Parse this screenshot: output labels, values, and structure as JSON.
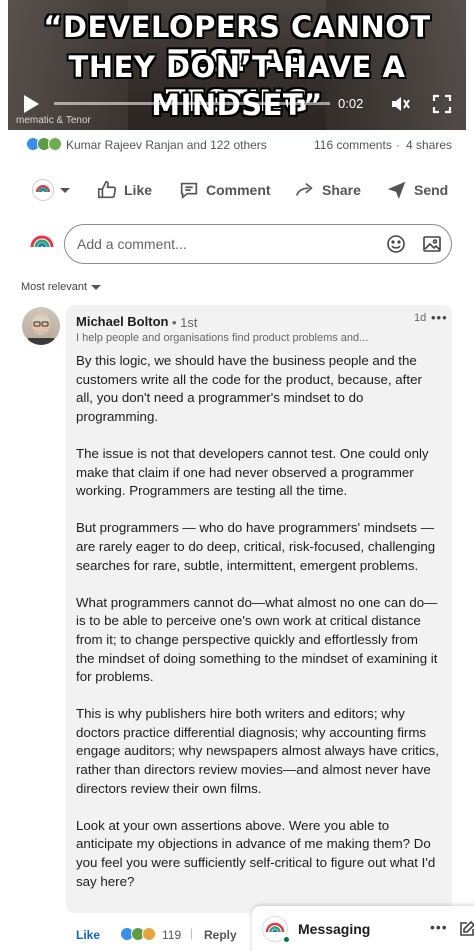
{
  "video": {
    "caption_lines": [
      "“DEVELOPERS CANNOT TEST AS",
      "THEY DON’T HAVE A TESTING",
      "MINDSET”"
    ],
    "time": "0:02",
    "progress": 0.0,
    "credit": "mematic & Tenor"
  },
  "social": {
    "reactors": "Kumar Rajeev Ranjan and 122 others",
    "comments": "116 comments",
    "shares": "4 shares"
  },
  "actions": {
    "like": "Like",
    "comment": "Comment",
    "share": "Share",
    "send": "Send"
  },
  "comment_box": {
    "placeholder": "Add a comment..."
  },
  "sort": {
    "label": "Most relevant"
  },
  "comment": {
    "author": "Michael Bolton",
    "degree": "• 1st",
    "headline": "I help people and organisations find product problems and...",
    "time": "1d",
    "paragraphs": [
      "By this logic, we should have the business people and the customers write all the code for the product, because, after all, you don't need a programmer's mindset to do programming.",
      "The issue is not that developers cannot test. One could only make that claim if one had never observed a programmer working. Programmers are testing all the time.",
      "But programmers — who do have programmers' mindsets — are rarely eager to do deep, critical, risk-focused, challenging searches for rare, subtle, intermittent, emergent problems.",
      "What programmers cannot do—what almost no one can do—is to be able to perceive one's own work at critical distance from it; to change perspective quickly and effortlessly from the mindset of doing something to the mindset of examining it for problems.",
      "This is why publishers hire both writers and editors; why doctors practice differential diagnosis; why accounting firms engage auditors; why newspapers almost always have critics, rather than directors review movies—and almost never have directors review their own films.",
      "Look at your own assertions above. Were you able to anticipate my objections in advance of me making them? Do you feel you were sufficiently self-critical to figure out what I'd say here?"
    ],
    "like_label": "Like",
    "reaction_count": "119",
    "separator": "|",
    "reply_label": "Reply"
  },
  "messaging": {
    "title": "Messaging"
  },
  "colors": {
    "link_blue": "#0a66c2",
    "bubble": "#f2f2f2",
    "online": "#057642"
  }
}
